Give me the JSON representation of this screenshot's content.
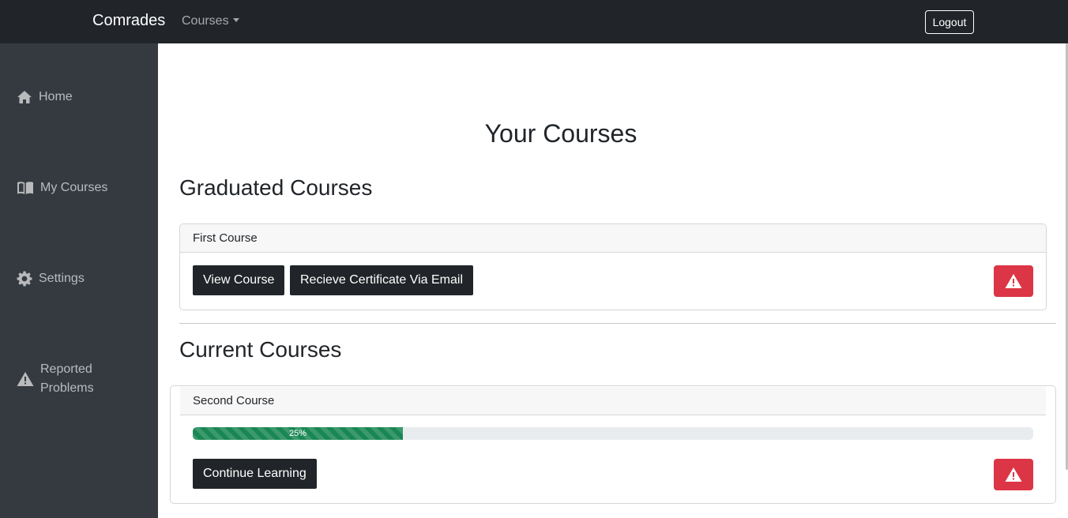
{
  "navbar": {
    "brand": "Comrades",
    "courses_menu": "Courses",
    "logout_label": "Logout"
  },
  "sidebar": {
    "items": [
      {
        "label": "Home",
        "icon": "home-icon"
      },
      {
        "label": "My Courses",
        "icon": "book-icon"
      },
      {
        "label": "Settings",
        "icon": "gear-icon"
      },
      {
        "label": "Reported Problems",
        "icon": "warning-icon"
      }
    ]
  },
  "main": {
    "page_title": "Your Courses",
    "graduated": {
      "title": "Graduated Courses",
      "courses": [
        {
          "name": "First Course",
          "view_label": "View Course",
          "certificate_label": "Recieve Certificate Via Email",
          "report_icon": "warning-icon"
        }
      ]
    },
    "current": {
      "title": "Current Courses",
      "courses": [
        {
          "name": "Second Course",
          "progress": 25,
          "progress_label": "25%",
          "continue_label": "Continue Learning",
          "report_icon": "warning-icon"
        }
      ]
    }
  },
  "colors": {
    "navbar": "#212529",
    "sidebar": "#343a40",
    "danger": "#dc3545",
    "progress": "#198754"
  }
}
